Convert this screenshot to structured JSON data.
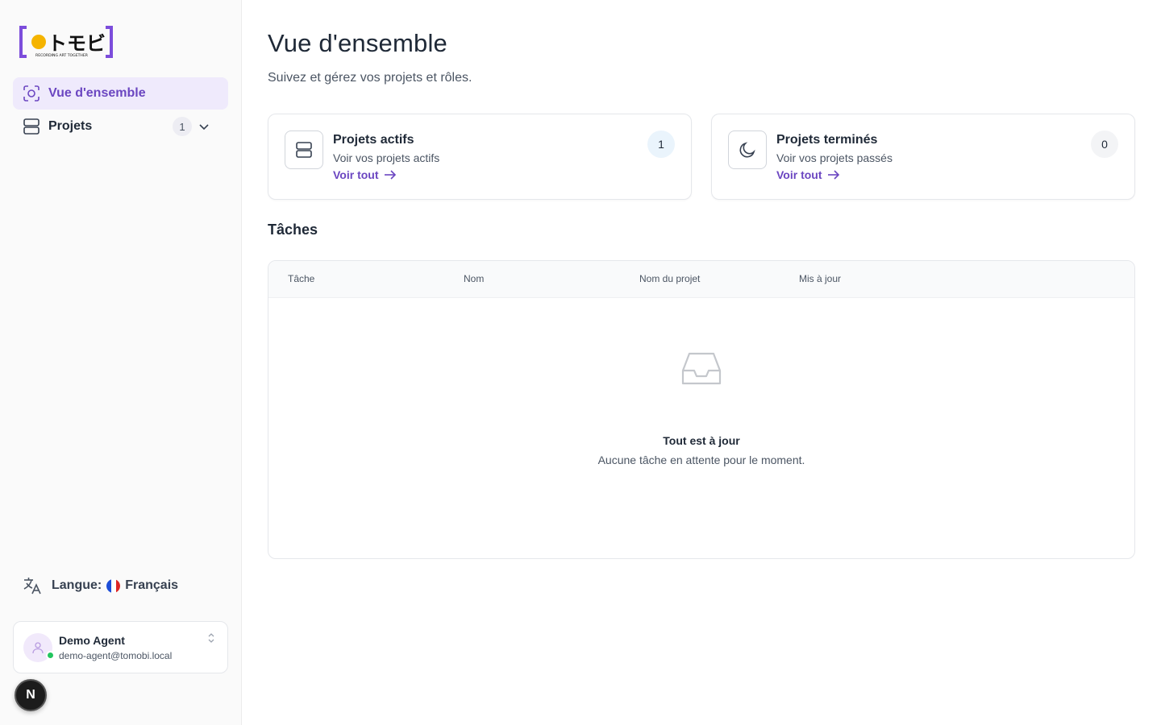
{
  "sidebar": {
    "logo_text": "トモビ",
    "logo_tagline": "RECORDING ART TOGETHER",
    "nav": [
      {
        "label": "Vue d'ensemble",
        "icon": "overview-icon",
        "active": true
      },
      {
        "label": "Projets",
        "icon": "projects-icon",
        "badge": "1",
        "active": false
      }
    ],
    "language": {
      "prefix": "Langue:",
      "value": "Français",
      "flag": [
        "#1d4ed8",
        "#ffffff",
        "#dc2626"
      ]
    },
    "user": {
      "name": "Demo Agent",
      "email": "demo-agent@tomobi.local",
      "status_color": "#22c55e"
    },
    "dev_badge": "N"
  },
  "main": {
    "title": "Vue d'ensemble",
    "subtitle": "Suivez et gérez vos projets et rôles.",
    "cards": [
      {
        "title": "Projets actifs",
        "description": "Voir vos projets actifs",
        "link": "Voir tout",
        "count": "1",
        "icon": "stack-icon"
      },
      {
        "title": "Projets terminés",
        "description": "Voir vos projets passés",
        "link": "Voir tout",
        "count": "0",
        "icon": "moon-icon"
      }
    ],
    "tasks": {
      "heading": "Tâches",
      "columns": [
        "Tâche",
        "Nom",
        "Nom du projet",
        "Mis à jour"
      ],
      "empty_title": "Tout est à jour",
      "empty_description": "Aucune tâche en attente pour le moment."
    }
  },
  "colors": {
    "accent": "#6b46c1",
    "accent_bg": "#efeafc",
    "logo_bracket": "#7c4ddb",
    "logo_dot": "#f5b400"
  }
}
